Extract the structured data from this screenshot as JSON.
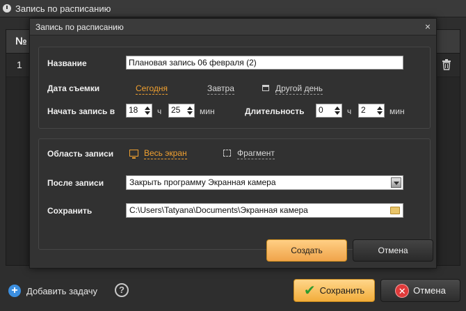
{
  "outer": {
    "title": "Запись по расписанию",
    "table": {
      "col_num": "№",
      "rows": [
        {
          "num": "1"
        }
      ]
    },
    "add_task": "Добавить задачу",
    "help": "?",
    "save": "Сохранить",
    "cancel": "Отмена"
  },
  "modal": {
    "title": "Запись по расписанию",
    "close": "×",
    "name_label": "Название",
    "name_value": "Плановая запись 06 февраля (2)",
    "date_label": "Дата съемки",
    "date_options": [
      "Сегодня",
      "Завтра",
      "Другой день"
    ],
    "date_selected": "Сегодня",
    "start_label": "Начать запись в",
    "start_hour": "18",
    "hour_unit": "ч",
    "start_min": "25",
    "min_unit": "мин",
    "duration_label": "Длительность",
    "duration_hour": "0",
    "duration_min": "2",
    "area_label": "Область записи",
    "area_options": [
      "Весь экран",
      "Фрагмент"
    ],
    "area_selected": "Весь экран",
    "after_label": "После записи",
    "after_value": "Закрыть программу Экранная камера",
    "save_label": "Сохранить",
    "save_path": "C:\\Users\\Tatyana\\Documents\\Экранная камера",
    "create": "Создать",
    "cancel": "Отмена"
  },
  "colors": {
    "accent": "#f0a030",
    "primary_button": "#f2ad3b",
    "add_icon": "#3c8fe0",
    "cancel_icon": "#e03a3a",
    "save_check": "#2e9b2e"
  },
  "icons": [
    "app-clock-icon",
    "trash-icon",
    "plus-icon",
    "help-icon",
    "check-icon",
    "close-circle-icon",
    "close-icon",
    "calendar-icon",
    "monitor-icon",
    "fragment-icon",
    "dropdown-arrow-icon",
    "folder-icon"
  ]
}
